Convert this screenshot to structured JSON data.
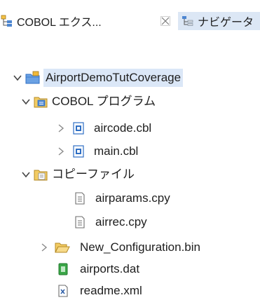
{
  "tabs": [
    {
      "label": "COBOL エクス...",
      "active": true
    },
    {
      "label": "ナビゲータ",
      "active": false
    }
  ],
  "tree": {
    "root": {
      "label": "AirportDemoTutCoverage",
      "expanded": true,
      "selected": true
    },
    "cobol_programs": {
      "label": "COBOL プログラム",
      "expanded": true,
      "items": [
        {
          "label": "aircode.cbl",
          "expanded": false
        },
        {
          "label": "main.cbl",
          "expanded": false
        }
      ]
    },
    "copybooks": {
      "label": "コピーファイル",
      "expanded": true,
      "items": [
        {
          "label": "airparams.cpy"
        },
        {
          "label": "airrec.cpy"
        }
      ]
    },
    "config_folder": {
      "label": "New_Configuration.bin",
      "expanded": false
    },
    "data_file": {
      "label": "airports.dat"
    },
    "xml_file": {
      "label": "readme.xml"
    }
  },
  "colors": {
    "selection": "#dbe7f7",
    "inactive_tab": "#dce7f5",
    "project_icon": "#2f6fc4",
    "folder_icon": "#e7b43c",
    "green_file": "#3aa647"
  }
}
